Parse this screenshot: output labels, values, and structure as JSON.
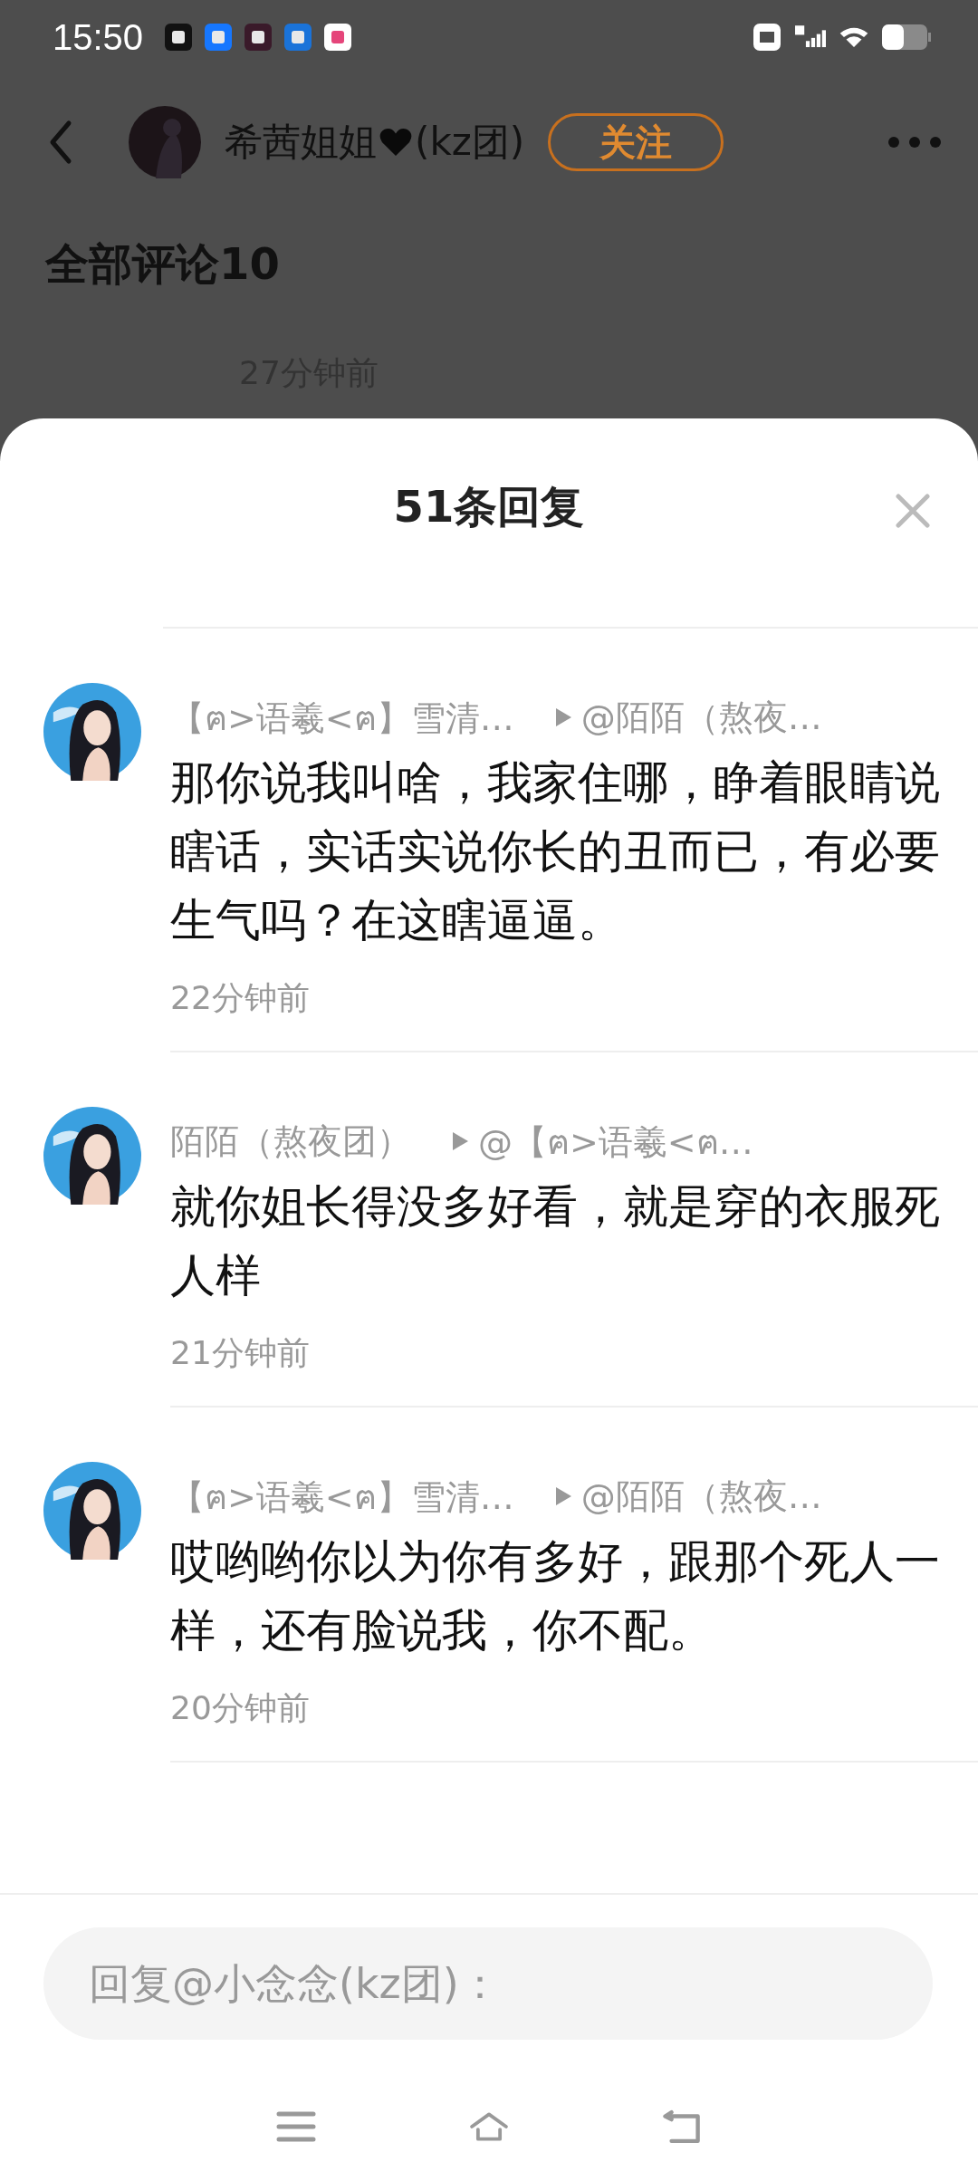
{
  "status_bar": {
    "time": "15:50"
  },
  "post_header": {
    "author": "希茜姐姐",
    "author_suffix": "(kz团)",
    "follow_label": "关注"
  },
  "comments_heading": "全部评论10",
  "background_comment": {
    "time": "27分钟前"
  },
  "reply_sheet": {
    "title": "51条回复",
    "replies": [
      {
        "author": "【ฅ>语羲<ฅ】雪清…",
        "reply_to": "@陌陌（熬夜…",
        "text": "那你说我叫啥，我家住哪，睁着眼睛说瞎话，实话实说你长的丑而已，有必要生气吗？在这瞎逼逼。",
        "time": "22分钟前"
      },
      {
        "author": "陌陌（熬夜团）",
        "reply_to": "@【ฅ>语羲<ฅ…",
        "text": "就你姐长得没多好看，就是穿的衣服死人样",
        "time": "21分钟前"
      },
      {
        "author": "【ฅ>语羲<ฅ】雪清…",
        "reply_to": "@陌陌（熬夜…",
        "text": "哎哟哟你以为你有多好，跟那个死人一样，还有脸说我，你不配。",
        "time": "20分钟前"
      }
    ]
  },
  "reply_input": {
    "placeholder": "回复@小念念(kz团)："
  }
}
